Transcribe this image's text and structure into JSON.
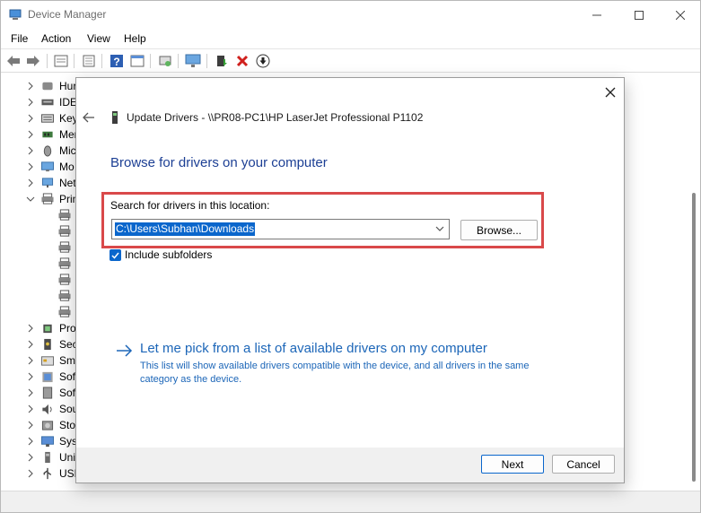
{
  "window": {
    "title": "Device Manager"
  },
  "menu": [
    "File",
    "Action",
    "View",
    "Help"
  ],
  "toolbar_icons": [
    "back-icon",
    "forward-icon",
    "properties-icon",
    "show-hidden-icon",
    "help-icon",
    "console-tree-icon",
    "scan-hardware-icon",
    "monitor-icon",
    "update-driver-icon",
    "uninstall-icon",
    "disable-icon"
  ],
  "tree": {
    "categories": [
      {
        "label": "Hur",
        "icon": "hid-icon"
      },
      {
        "label": "IDE",
        "icon": "ide-icon"
      },
      {
        "label": "Key",
        "icon": "keyboard-icon"
      },
      {
        "label": "Mer",
        "icon": "memory-icon"
      },
      {
        "label": "Mic",
        "icon": "mouse-icon"
      },
      {
        "label": "Mo",
        "icon": "monitor-icon"
      },
      {
        "label": "Net",
        "icon": "network-icon"
      },
      {
        "label": "Prin",
        "icon": "printer-icon",
        "expanded": true
      },
      {
        "label": "Pro",
        "icon": "processor-icon"
      },
      {
        "label": "Sec",
        "icon": "security-icon"
      },
      {
        "label": "Sma",
        "icon": "smartcard-icon"
      },
      {
        "label": "Soft",
        "icon": "software-icon"
      },
      {
        "label": "Soft",
        "icon": "software-device-icon"
      },
      {
        "label": "Sou",
        "icon": "sound-icon"
      },
      {
        "label": "Stor",
        "icon": "storage-icon"
      },
      {
        "label": "Syst",
        "icon": "system-icon"
      },
      {
        "label": "Uni",
        "icon": "usb-icon"
      },
      {
        "label": "USE",
        "icon": "usb-connector-icon"
      }
    ],
    "printer_children": 7
  },
  "dialog": {
    "title": "Update Drivers - \\\\PR08-PC1\\HP LaserJet Professional P1102",
    "heading": "Browse for drivers on your computer",
    "search_label": "Search for drivers in this location:",
    "path_value": "C:\\Users\\Subhan\\Downloads",
    "browse_label": "Browse...",
    "include_subfolders_label": "Include subfolders",
    "include_subfolders_checked": true,
    "pick_link": "Let me pick from a list of available drivers on my computer",
    "pick_desc": "This list will show available drivers compatible with the device, and all drivers in the same category as the device.",
    "next_label": "Next",
    "cancel_label": "Cancel"
  },
  "colors": {
    "accent": "#0a66cc",
    "heading": "#1c3f94",
    "link": "#1c66b8",
    "highlight": "#d9494a"
  }
}
